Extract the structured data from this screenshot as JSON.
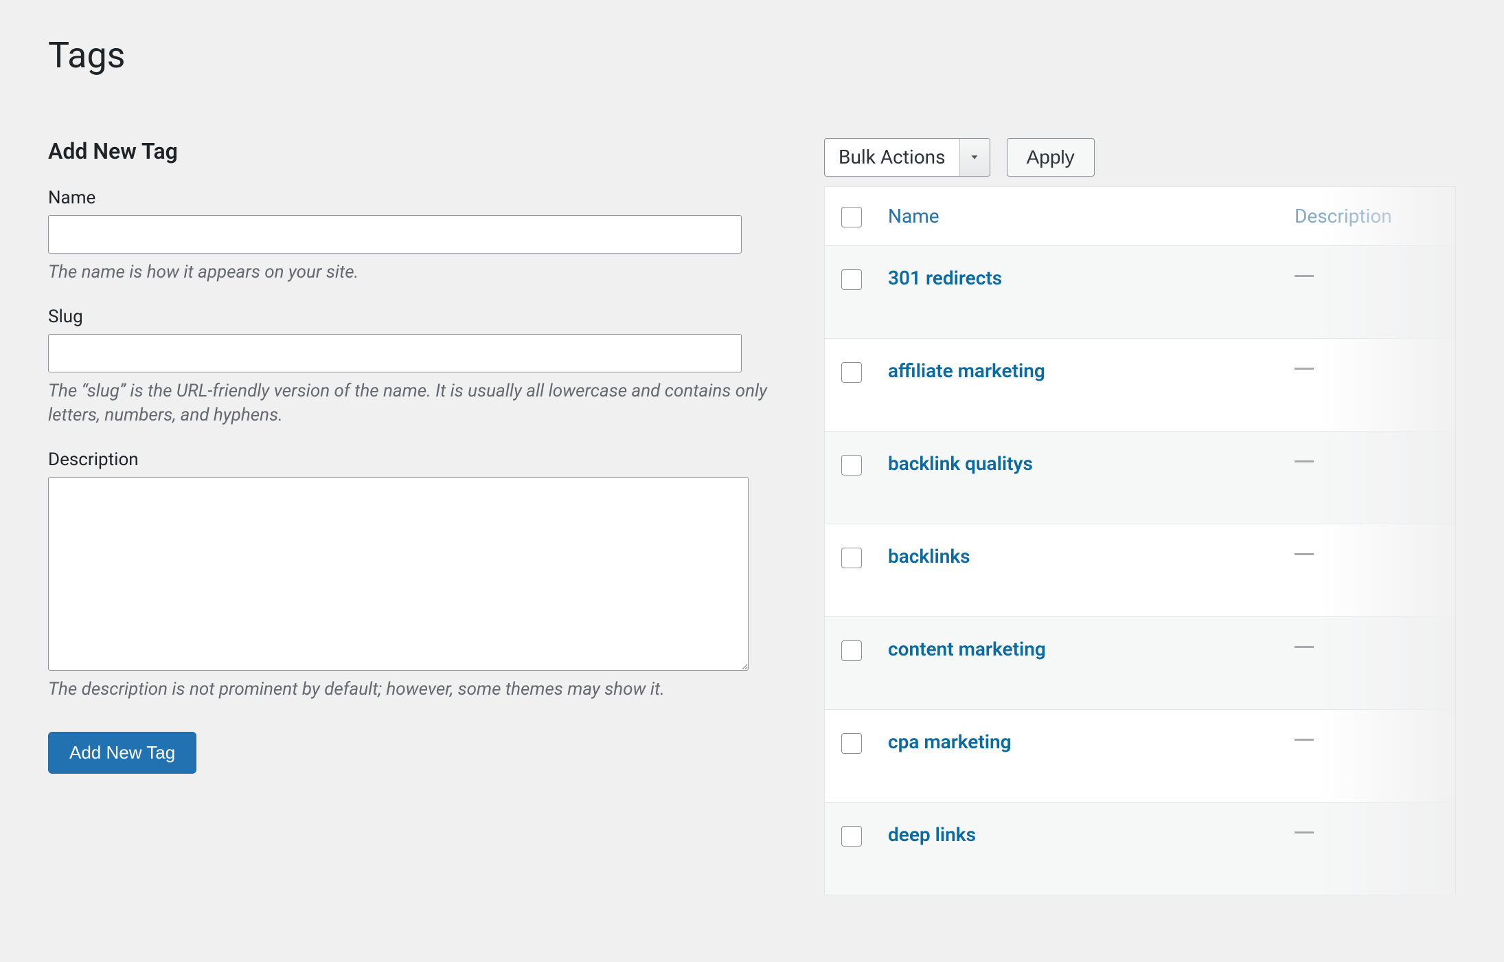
{
  "page": {
    "title": "Tags"
  },
  "form": {
    "title": "Add New Tag",
    "name": {
      "label": "Name",
      "value": "",
      "hint": "The name is how it appears on your site."
    },
    "slug": {
      "label": "Slug",
      "value": "",
      "hint": "The “slug” is the URL-friendly version of the name. It is usually all lowercase and contains only letters, numbers, and hyphens."
    },
    "description": {
      "label": "Description",
      "value": "",
      "hint": "The description is not prominent by default; however, some themes may show it."
    },
    "submit_label": "Add New Tag"
  },
  "bulk": {
    "selected_label": "Bulk Actions",
    "apply_label": "Apply"
  },
  "table": {
    "columns": {
      "name": "Name",
      "description": "Description"
    },
    "rows": [
      {
        "name": "301 redirects",
        "description": ""
      },
      {
        "name": "affiliate marketing",
        "description": ""
      },
      {
        "name": "backlink qualitys",
        "description": ""
      },
      {
        "name": "backlinks",
        "description": ""
      },
      {
        "name": "content marketing",
        "description": ""
      },
      {
        "name": "cpa marketing",
        "description": ""
      },
      {
        "name": "deep links",
        "description": ""
      }
    ]
  }
}
